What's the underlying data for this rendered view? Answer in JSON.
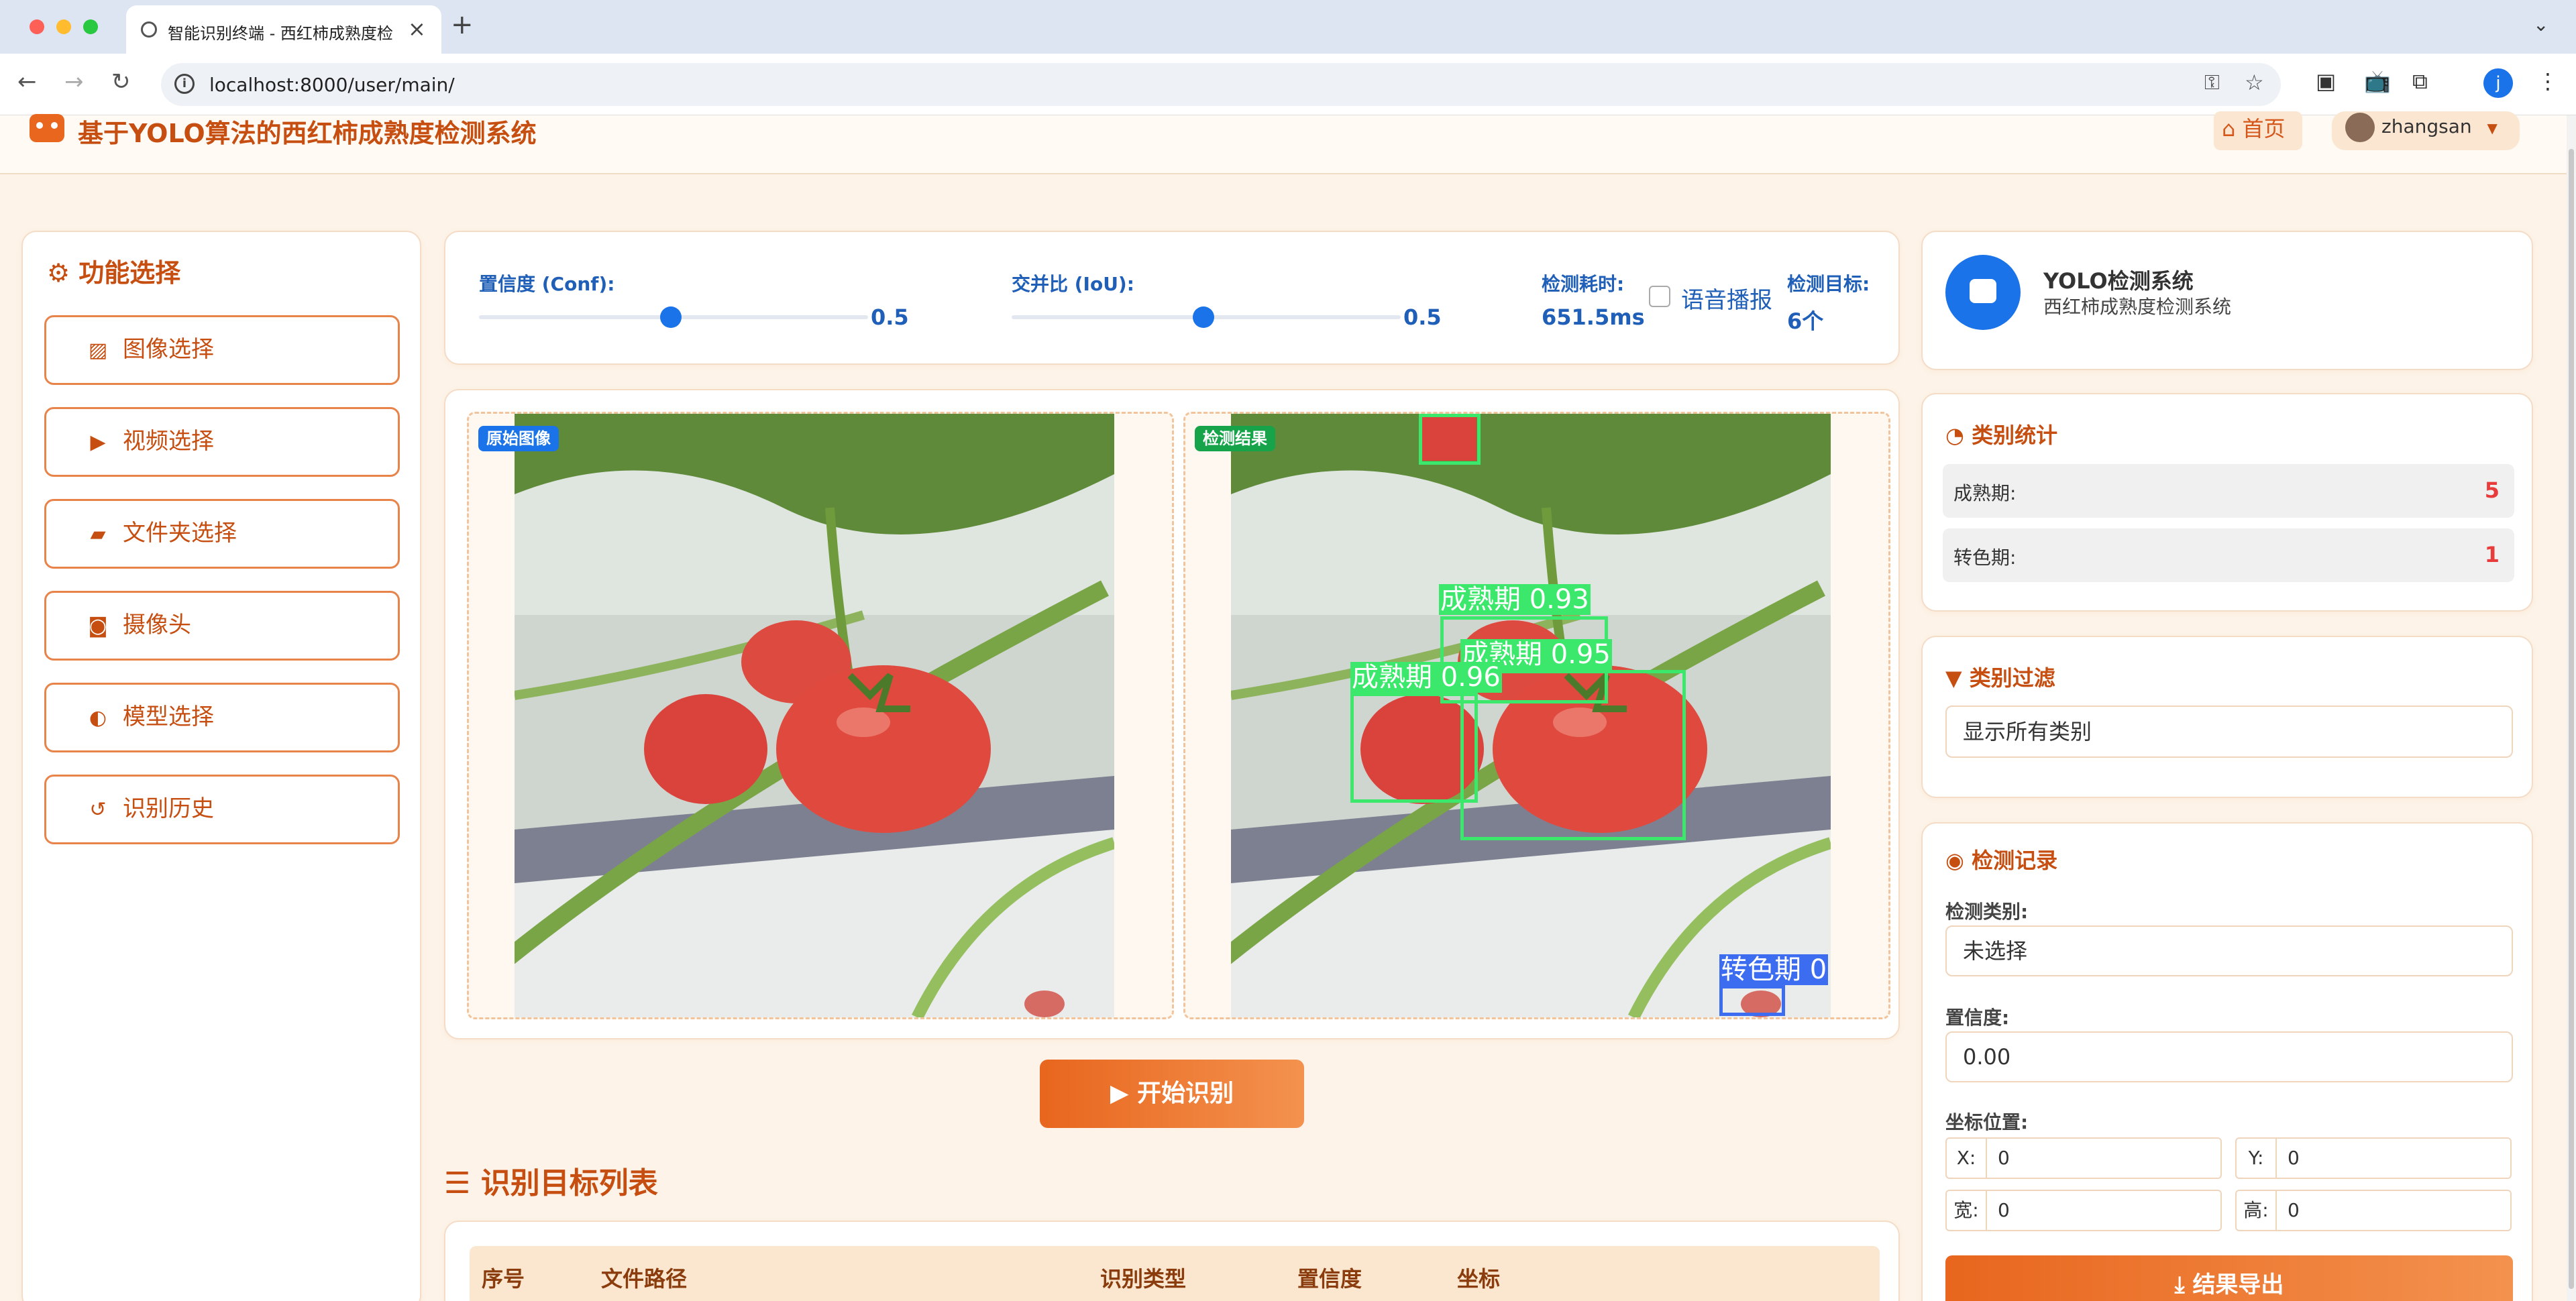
{
  "browser": {
    "tab_title": "智能识别终端 - 西红柿成熟度检",
    "tab_close": "×",
    "new_tab": "+",
    "url": "localhost:8000/user/main/",
    "profile_initial": "j"
  },
  "header": {
    "title": "基于YOLO算法的西红柿成熟度检测系统",
    "home_label": "首页",
    "username": "zhangsan"
  },
  "sidebar": {
    "title": "功能选择",
    "items": [
      {
        "label": "图像选择",
        "icon": "image-icon"
      },
      {
        "label": "视频选择",
        "icon": "video-icon"
      },
      {
        "label": "文件夹选择",
        "icon": "folder-icon"
      },
      {
        "label": "摄像头",
        "icon": "camera-icon"
      },
      {
        "label": "模型选择",
        "icon": "model-icon"
      },
      {
        "label": "识别历史",
        "icon": "history-icon"
      }
    ]
  },
  "params": {
    "conf_label": "置信度 (Conf):",
    "conf_value": "0.5",
    "iou_label": "交并比 (IoU):",
    "iou_value": "0.5",
    "time_label": "检测耗时:",
    "time_value": "651.5ms",
    "voice_label": "语音播报",
    "target_label": "检测目标:",
    "target_value": "6个"
  },
  "images": {
    "original_badge": "原始图像",
    "result_badge": "检测结果",
    "detections": [
      {
        "label": "成熟期 0.93"
      },
      {
        "label": "成熟期 0.95"
      },
      {
        "label": "成熟期 0.96"
      },
      {
        "label": "转色期 0"
      }
    ]
  },
  "actions": {
    "start_label": "开始识别"
  },
  "list": {
    "title": "识别目标列表",
    "columns": [
      "序号",
      "文件路径",
      "识别类型",
      "置信度",
      "坐标"
    ]
  },
  "system": {
    "title": "YOLO检测系统",
    "subtitle": "西红柿成熟度检测系统"
  },
  "stats": {
    "title": "类别统计",
    "rows": [
      {
        "label": "成熟期:",
        "value": "5"
      },
      {
        "label": "转色期:",
        "value": "1"
      }
    ]
  },
  "filter": {
    "title": "类别过滤",
    "selected": "显示所有类别"
  },
  "record": {
    "title": "检测记录",
    "class_label": "检测类别:",
    "class_value": "未选择",
    "conf_label": "置信度:",
    "conf_value": "0.00",
    "coord_label": "坐标位置:",
    "x_label": "X:",
    "x_value": "0",
    "y_label": "Y:",
    "y_value": "0",
    "w_label": "宽:",
    "w_value": "0",
    "h_label": "高:",
    "h_value": "0",
    "export_label": "结果导出"
  },
  "colors": {
    "brand": "#c64e10",
    "accent_blue": "#1a73e8",
    "box_green": "#3be86b",
    "box_blue": "#3c6cf0"
  }
}
